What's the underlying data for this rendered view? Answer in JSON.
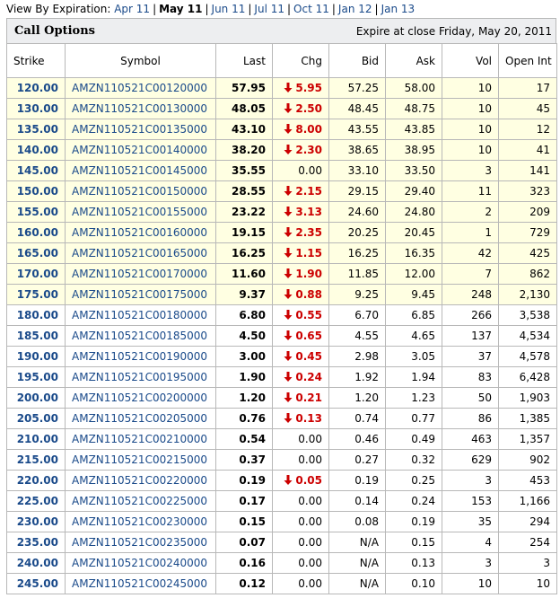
{
  "expiration_bar": {
    "label": "View By Expiration:",
    "options": [
      {
        "label": "Apr 11",
        "selected": false
      },
      {
        "label": "May 11",
        "selected": true
      },
      {
        "label": "Jun 11",
        "selected": false
      },
      {
        "label": "Jul 11",
        "selected": false
      },
      {
        "label": "Oct 11",
        "selected": false
      },
      {
        "label": "Jan 12",
        "selected": false
      },
      {
        "label": "Jan 13",
        "selected": false
      }
    ],
    "separator": "|"
  },
  "panel": {
    "title": "Call Options",
    "expire_text": "Expire at close Friday, May 20, 2011"
  },
  "columns": [
    "Strike",
    "Symbol",
    "Last",
    "Chg",
    "Bid",
    "Ask",
    "Vol",
    "Open Int"
  ],
  "colors": {
    "link": "#1a4a8a",
    "down": "#cc0000",
    "in_the_money_bg": "#ffffe2",
    "header_bg": "#edeef0"
  },
  "rows": [
    {
      "strike": "120.00",
      "symbol": "AMZN110521C00120000",
      "last": "57.95",
      "chg": "5.95",
      "dir": "down",
      "bid": "57.25",
      "ask": "58.00",
      "vol": "10",
      "oi": "17",
      "itm": true
    },
    {
      "strike": "130.00",
      "symbol": "AMZN110521C00130000",
      "last": "48.05",
      "chg": "2.50",
      "dir": "down",
      "bid": "48.45",
      "ask": "48.75",
      "vol": "10",
      "oi": "45",
      "itm": true
    },
    {
      "strike": "135.00",
      "symbol": "AMZN110521C00135000",
      "last": "43.10",
      "chg": "8.00",
      "dir": "down",
      "bid": "43.55",
      "ask": "43.85",
      "vol": "10",
      "oi": "12",
      "itm": true
    },
    {
      "strike": "140.00",
      "symbol": "AMZN110521C00140000",
      "last": "38.20",
      "chg": "2.30",
      "dir": "down",
      "bid": "38.65",
      "ask": "38.95",
      "vol": "10",
      "oi": "41",
      "itm": true
    },
    {
      "strike": "145.00",
      "symbol": "AMZN110521C00145000",
      "last": "35.55",
      "chg": "0.00",
      "dir": "none",
      "bid": "33.10",
      "ask": "33.50",
      "vol": "3",
      "oi": "141",
      "itm": true
    },
    {
      "strike": "150.00",
      "symbol": "AMZN110521C00150000",
      "last": "28.55",
      "chg": "2.15",
      "dir": "down",
      "bid": "29.15",
      "ask": "29.40",
      "vol": "11",
      "oi": "323",
      "itm": true
    },
    {
      "strike": "155.00",
      "symbol": "AMZN110521C00155000",
      "last": "23.22",
      "chg": "3.13",
      "dir": "down",
      "bid": "24.60",
      "ask": "24.80",
      "vol": "2",
      "oi": "209",
      "itm": true
    },
    {
      "strike": "160.00",
      "symbol": "AMZN110521C00160000",
      "last": "19.15",
      "chg": "2.35",
      "dir": "down",
      "bid": "20.25",
      "ask": "20.45",
      "vol": "1",
      "oi": "729",
      "itm": true
    },
    {
      "strike": "165.00",
      "symbol": "AMZN110521C00165000",
      "last": "16.25",
      "chg": "1.15",
      "dir": "down",
      "bid": "16.25",
      "ask": "16.35",
      "vol": "42",
      "oi": "425",
      "itm": true
    },
    {
      "strike": "170.00",
      "symbol": "AMZN110521C00170000",
      "last": "11.60",
      "chg": "1.90",
      "dir": "down",
      "bid": "11.85",
      "ask": "12.00",
      "vol": "7",
      "oi": "862",
      "itm": true
    },
    {
      "strike": "175.00",
      "symbol": "AMZN110521C00175000",
      "last": "9.37",
      "chg": "0.88",
      "dir": "down",
      "bid": "9.25",
      "ask": "9.45",
      "vol": "248",
      "oi": "2,130",
      "itm": true
    },
    {
      "strike": "180.00",
      "symbol": "AMZN110521C00180000",
      "last": "6.80",
      "chg": "0.55",
      "dir": "down",
      "bid": "6.70",
      "ask": "6.85",
      "vol": "266",
      "oi": "3,538",
      "itm": false
    },
    {
      "strike": "185.00",
      "symbol": "AMZN110521C00185000",
      "last": "4.50",
      "chg": "0.65",
      "dir": "down",
      "bid": "4.55",
      "ask": "4.65",
      "vol": "137",
      "oi": "4,534",
      "itm": false
    },
    {
      "strike": "190.00",
      "symbol": "AMZN110521C00190000",
      "last": "3.00",
      "chg": "0.45",
      "dir": "down",
      "bid": "2.98",
      "ask": "3.05",
      "vol": "37",
      "oi": "4,578",
      "itm": false
    },
    {
      "strike": "195.00",
      "symbol": "AMZN110521C00195000",
      "last": "1.90",
      "chg": "0.24",
      "dir": "down",
      "bid": "1.92",
      "ask": "1.94",
      "vol": "83",
      "oi": "6,428",
      "itm": false
    },
    {
      "strike": "200.00",
      "symbol": "AMZN110521C00200000",
      "last": "1.20",
      "chg": "0.21",
      "dir": "down",
      "bid": "1.20",
      "ask": "1.23",
      "vol": "50",
      "oi": "1,903",
      "itm": false
    },
    {
      "strike": "205.00",
      "symbol": "AMZN110521C00205000",
      "last": "0.76",
      "chg": "0.13",
      "dir": "down",
      "bid": "0.74",
      "ask": "0.77",
      "vol": "86",
      "oi": "1,385",
      "itm": false
    },
    {
      "strike": "210.00",
      "symbol": "AMZN110521C00210000",
      "last": "0.54",
      "chg": "0.00",
      "dir": "none",
      "bid": "0.46",
      "ask": "0.49",
      "vol": "463",
      "oi": "1,357",
      "itm": false
    },
    {
      "strike": "215.00",
      "symbol": "AMZN110521C00215000",
      "last": "0.37",
      "chg": "0.00",
      "dir": "none",
      "bid": "0.27",
      "ask": "0.32",
      "vol": "629",
      "oi": "902",
      "itm": false
    },
    {
      "strike": "220.00",
      "symbol": "AMZN110521C00220000",
      "last": "0.19",
      "chg": "0.05",
      "dir": "down",
      "bid": "0.19",
      "ask": "0.25",
      "vol": "3",
      "oi": "453",
      "itm": false
    },
    {
      "strike": "225.00",
      "symbol": "AMZN110521C00225000",
      "last": "0.17",
      "chg": "0.00",
      "dir": "none",
      "bid": "0.14",
      "ask": "0.24",
      "vol": "153",
      "oi": "1,166",
      "itm": false
    },
    {
      "strike": "230.00",
      "symbol": "AMZN110521C00230000",
      "last": "0.15",
      "chg": "0.00",
      "dir": "none",
      "bid": "0.08",
      "ask": "0.19",
      "vol": "35",
      "oi": "294",
      "itm": false
    },
    {
      "strike": "235.00",
      "symbol": "AMZN110521C00235000",
      "last": "0.07",
      "chg": "0.00",
      "dir": "none",
      "bid": "N/A",
      "ask": "0.15",
      "vol": "4",
      "oi": "254",
      "itm": false
    },
    {
      "strike": "240.00",
      "symbol": "AMZN110521C00240000",
      "last": "0.16",
      "chg": "0.00",
      "dir": "none",
      "bid": "N/A",
      "ask": "0.13",
      "vol": "3",
      "oi": "3",
      "itm": false
    },
    {
      "strike": "245.00",
      "symbol": "AMZN110521C00245000",
      "last": "0.12",
      "chg": "0.00",
      "dir": "none",
      "bid": "N/A",
      "ask": "0.10",
      "vol": "10",
      "oi": "10",
      "itm": false
    }
  ]
}
